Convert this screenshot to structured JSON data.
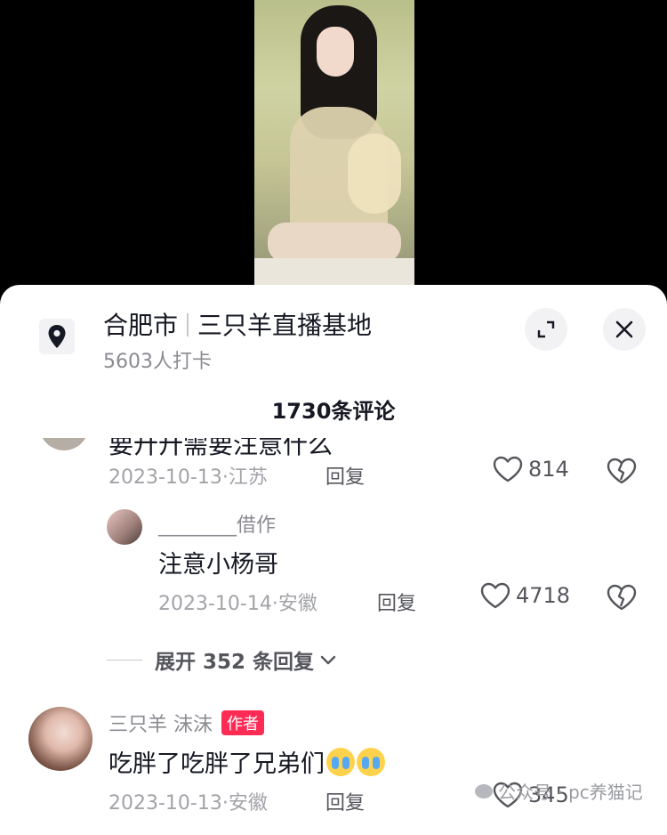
{
  "location": {
    "city": "合肥市",
    "place": "三只羊直播基地",
    "checkins": "5603人打卡"
  },
  "comment_count_label": "1730条评论",
  "comments": [
    {
      "partial_text": "要廾廾需要注意什么",
      "meta": "2023-10-13·江苏",
      "reply_label": "回复",
      "likes": "814"
    }
  ],
  "reply": {
    "username": "________借作",
    "text": "注意小杨哥",
    "meta": "2023-10-14·安徽",
    "reply_label": "回复",
    "likes": "4718"
  },
  "expand_replies_label": "展开 352 条回复",
  "author_comment": {
    "username": "三只羊 沫沫",
    "badge": "作者",
    "text": "吃胖了吃胖了兄弟们",
    "meta": "2023-10-13·安徽",
    "reply_label": "回复",
    "likes": "345"
  },
  "watermark": "公众号 · pc养猫记",
  "colors": {
    "accent": "#fe2c55",
    "primary_text": "#161823",
    "secondary_text": "#a2a3a8"
  }
}
